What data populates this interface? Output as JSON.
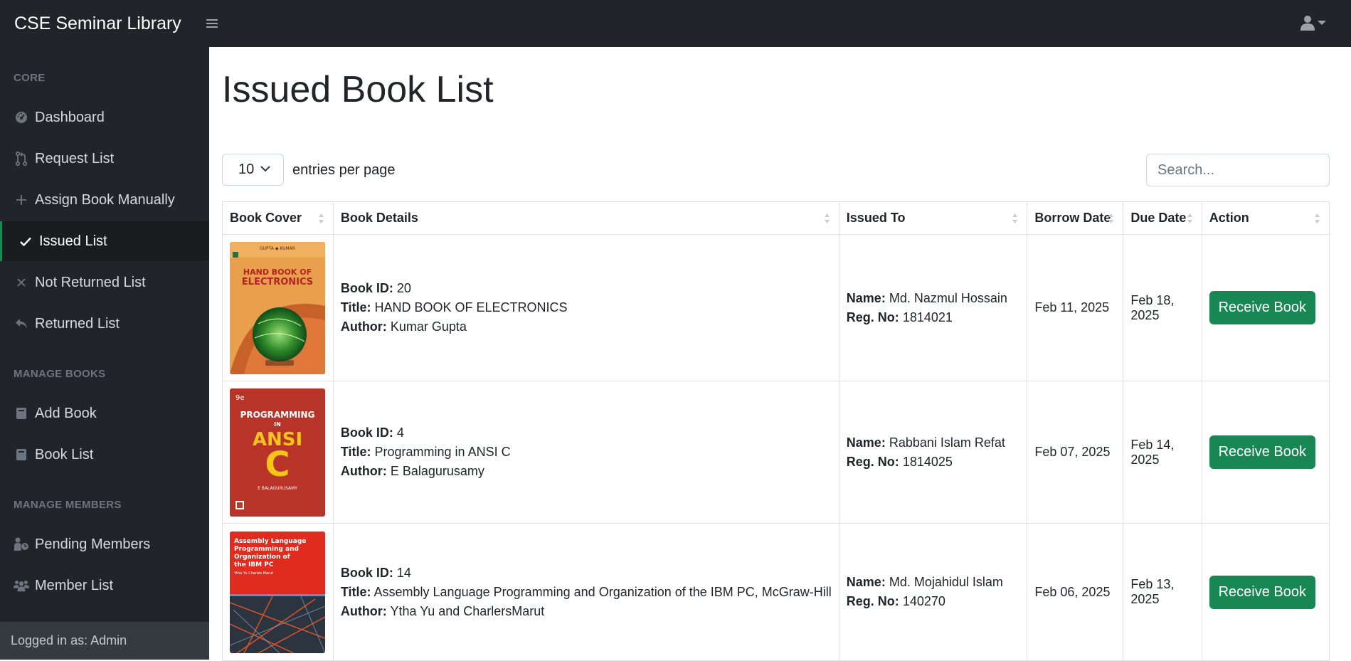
{
  "app": {
    "brand": "CSE Seminar Library"
  },
  "sidebar": {
    "sections": [
      {
        "heading": "CORE"
      },
      {
        "heading": "MANAGE BOOKS"
      },
      {
        "heading": "MANAGE MEMBERS"
      }
    ],
    "items": [
      {
        "label": "Dashboard",
        "icon": "dashboard-icon"
      },
      {
        "label": "Request List",
        "icon": "pull-request-icon"
      },
      {
        "label": "Assign Book Manually",
        "icon": "plus-icon"
      },
      {
        "label": "Issued List",
        "icon": "check-icon",
        "active": true
      },
      {
        "label": "Not Returned List",
        "icon": "x-icon"
      },
      {
        "label": "Returned List",
        "icon": "reply-icon"
      },
      {
        "label": "Add Book",
        "icon": "book-icon"
      },
      {
        "label": "Book List",
        "icon": "book-icon"
      },
      {
        "label": "Pending Members",
        "icon": "person-clock-icon"
      },
      {
        "label": "Member List",
        "icon": "users-icon"
      }
    ],
    "footer": "Logged in as: Admin"
  },
  "main": {
    "title": "Issued Book List",
    "entries": {
      "value": "10",
      "label": "entries per page"
    },
    "search": {
      "placeholder": "Search..."
    },
    "columns": [
      "Book Cover",
      "Book Details",
      "Issued To",
      "Borrow Date",
      "Due Date",
      "Action"
    ],
    "field_labels": {
      "book_id": "Book ID:",
      "title": "Title:",
      "author": "Author:",
      "name": "Name:",
      "reg": "Reg. No:"
    },
    "rows": [
      {
        "book_id": "20",
        "title": "HAND BOOK OF ELECTRONICS",
        "author": "Kumar Gupta",
        "name": "Md. Nazmul Hossain",
        "reg": "1814021",
        "borrow_date": "Feb 11, 2025",
        "due_date": "Feb 18, 2025",
        "action": "Receive Book",
        "cover": {
          "top_text": "GUPTA  ◆  KUMAR",
          "line1": "HAND BOOK OF",
          "line2": "ELECTRONICS"
        }
      },
      {
        "book_id": "4",
        "title": "Programming in ANSI C",
        "author": "E Balagurusamy",
        "name": "Rabbani Islam Refat",
        "reg": "1814025",
        "borrow_date": "Feb 07, 2025",
        "due_date": "Feb 14, 2025",
        "action": "Receive Book",
        "cover": {
          "edition": "9e",
          "line1": "PROGRAMMING",
          "line2": "IN",
          "line3": "ANSI",
          "line4": "C",
          "author": "E BALAGURUSAMY"
        }
      },
      {
        "book_id": "14",
        "title": "Assembly Language Programming and Organization of the IBM PC, McGraw-Hill",
        "author": "Ytha Yu and CharlersMarut",
        "name": "Md. Mojahidul Islam",
        "reg": "140270",
        "borrow_date": "Feb 06, 2025",
        "due_date": "Feb 13, 2025",
        "action": "Receive Book",
        "cover": {
          "line1": "Assembly Language",
          "line2": "Programming and",
          "line3": "Organization of",
          "line4": "the IBM PC",
          "authors": "Ytha Yu\nCharles Marut"
        }
      }
    ]
  },
  "colors": {
    "sidebar_bg": "#212529",
    "active_accent": "#198754",
    "button_green": "#198754"
  }
}
